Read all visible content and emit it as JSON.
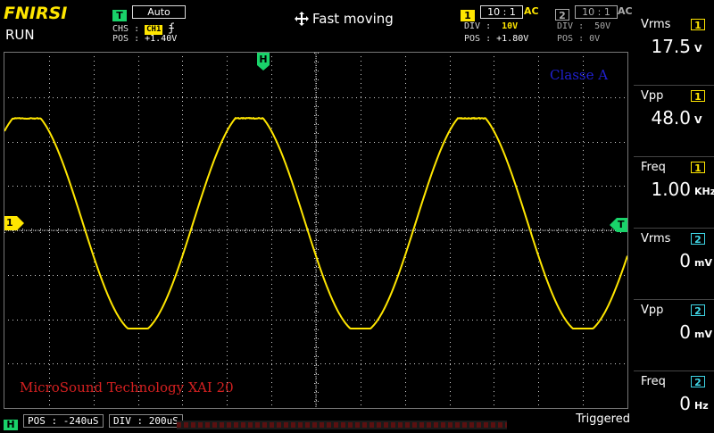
{
  "header": {
    "brand": "FNIRSI",
    "run_state": "RUN",
    "trigger_badge": "T",
    "trigger_mode": "Auto",
    "chs_label": "CHS :",
    "chs_value": "CH1",
    "edge_symbol": "ʄ",
    "trig_pos_label": "POS :",
    "trig_pos_value": "+1.40V",
    "move_mode": "Fast moving",
    "ch1": {
      "badge": "1",
      "probe": "10 : 1",
      "coupling": "AC",
      "div_label": "DIV :",
      "div_value": "10V",
      "pos_label": "POS :",
      "pos_value": "+1.80V"
    },
    "ch2": {
      "badge": "2",
      "probe": "10 : 1",
      "coupling": "AC",
      "div_label": "DIV :",
      "div_value": "50V",
      "pos_label": "POS :",
      "pos_value": "0V"
    }
  },
  "screen": {
    "h_marker": "H",
    "ch1_marker": "1",
    "trig_marker": "T",
    "annotation_top": "Classe A",
    "annotation_bottom": "MicroSound Technology XAI 20",
    "colors": {
      "trace": "#ffe600",
      "grid": "#cfcfcf",
      "annot_top": "#2020d0",
      "annot_bottom": "#d42020",
      "marker_green": "#19d36a"
    }
  },
  "measurements": [
    {
      "label": "Vrms",
      "ch": "1",
      "value": "17.5",
      "unit": "V"
    },
    {
      "label": "Vpp",
      "ch": "1",
      "value": "48.0",
      "unit": "V"
    },
    {
      "label": "Freq",
      "ch": "1",
      "value": "1.00",
      "unit": "KHz"
    },
    {
      "label": "Vrms",
      "ch": "2",
      "value": "0",
      "unit": "mV"
    },
    {
      "label": "Vpp",
      "ch": "2",
      "value": "0",
      "unit": "mV"
    },
    {
      "label": "Freq",
      "ch": "2",
      "value": "0",
      "unit": "Hz"
    }
  ],
  "footer": {
    "h_badge": "H",
    "pos_label": "POS :",
    "pos_value": "-240uS",
    "div_label": "DIV :",
    "div_value": "200uS",
    "status": "Triggered"
  }
}
